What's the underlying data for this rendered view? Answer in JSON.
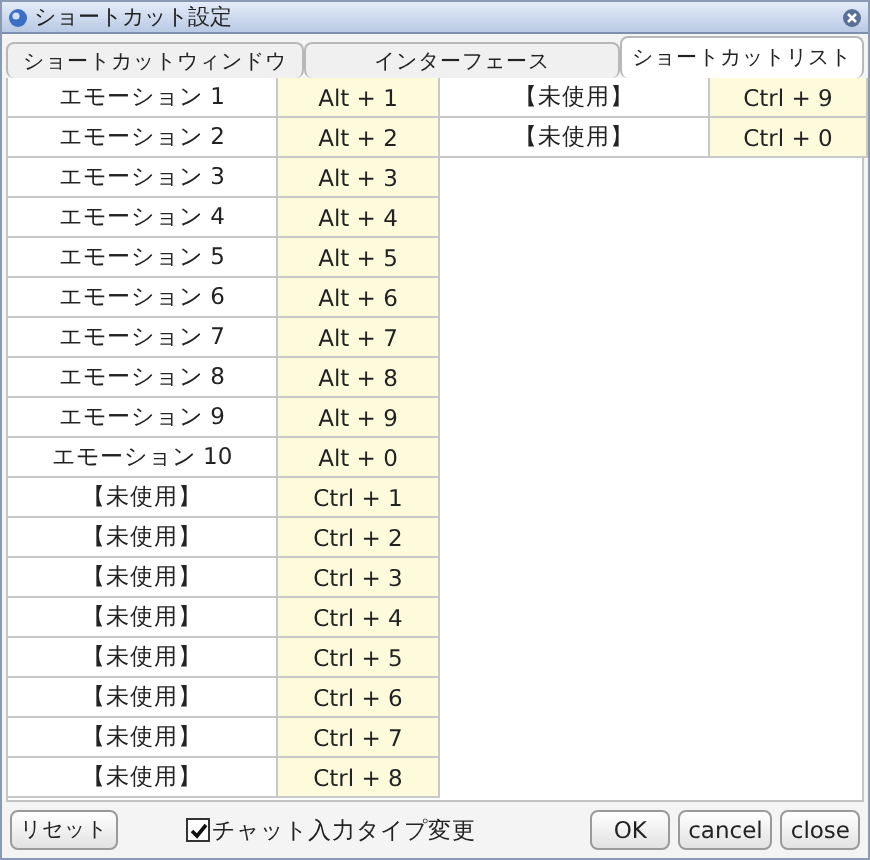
{
  "window": {
    "title": "ショートカット設定"
  },
  "tabs": [
    {
      "label": "ショートカットウィンドウ",
      "selected": false
    },
    {
      "label": "インターフェース",
      "selected": false
    },
    {
      "label": "ショートカットリスト",
      "selected": true
    }
  ],
  "shortcut_columns": [
    {
      "rows": [
        {
          "action": "エモーション 1",
          "key": "Alt + 1"
        },
        {
          "action": "エモーション 2",
          "key": "Alt + 2"
        },
        {
          "action": "エモーション 3",
          "key": "Alt + 3"
        },
        {
          "action": "エモーション 4",
          "key": "Alt + 4"
        },
        {
          "action": "エモーション 5",
          "key": "Alt + 5"
        },
        {
          "action": "エモーション 6",
          "key": "Alt + 6"
        },
        {
          "action": "エモーション 7",
          "key": "Alt + 7"
        },
        {
          "action": "エモーション 8",
          "key": "Alt + 8"
        },
        {
          "action": "エモーション 9",
          "key": "Alt + 9"
        },
        {
          "action": "エモーション 10",
          "key": "Alt + 0"
        },
        {
          "action": "【未使用】",
          "key": "Ctrl + 1"
        },
        {
          "action": "【未使用】",
          "key": "Ctrl + 2"
        },
        {
          "action": "【未使用】",
          "key": "Ctrl + 3"
        },
        {
          "action": "【未使用】",
          "key": "Ctrl + 4"
        },
        {
          "action": "【未使用】",
          "key": "Ctrl + 5"
        },
        {
          "action": "【未使用】",
          "key": "Ctrl + 6"
        },
        {
          "action": "【未使用】",
          "key": "Ctrl + 7"
        },
        {
          "action": "【未使用】",
          "key": "Ctrl + 8"
        }
      ]
    },
    {
      "rows": [
        {
          "action": "【未使用】",
          "key": "Ctrl + 9"
        },
        {
          "action": "【未使用】",
          "key": "Ctrl + 0"
        }
      ]
    }
  ],
  "footer": {
    "reset_button": "リセット",
    "chat_checkbox": {
      "label": "チャット入力タイプ変更",
      "checked": true
    },
    "buttons": [
      "OK",
      "cancel",
      "close"
    ]
  }
}
